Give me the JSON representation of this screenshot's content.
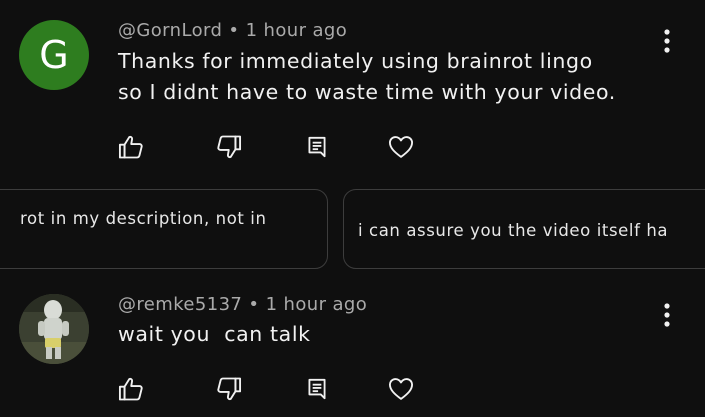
{
  "comments": [
    {
      "avatar_letter": "G",
      "handle": "@GornLord",
      "separator": "•",
      "time": "1 hour ago",
      "lines": [
        "Thanks for immediately using brainrot lingo",
        "so I didnt have to waste time with your video."
      ]
    },
    {
      "handle": "@remke5137",
      "separator": "•",
      "time": "1 hour ago",
      "lines": [
        "wait you  can talk"
      ]
    }
  ],
  "replies": [
    "rot in my description, not in",
    "i can assure you the video itself ha"
  ],
  "colors": {
    "background": "#0f0f0f",
    "avatar_g": "#2e7d1f",
    "meta_text": "#aaaaaa"
  },
  "icons": [
    "like-icon",
    "dislike-icon",
    "reply-icon",
    "heart-icon",
    "more-vert-icon"
  ]
}
